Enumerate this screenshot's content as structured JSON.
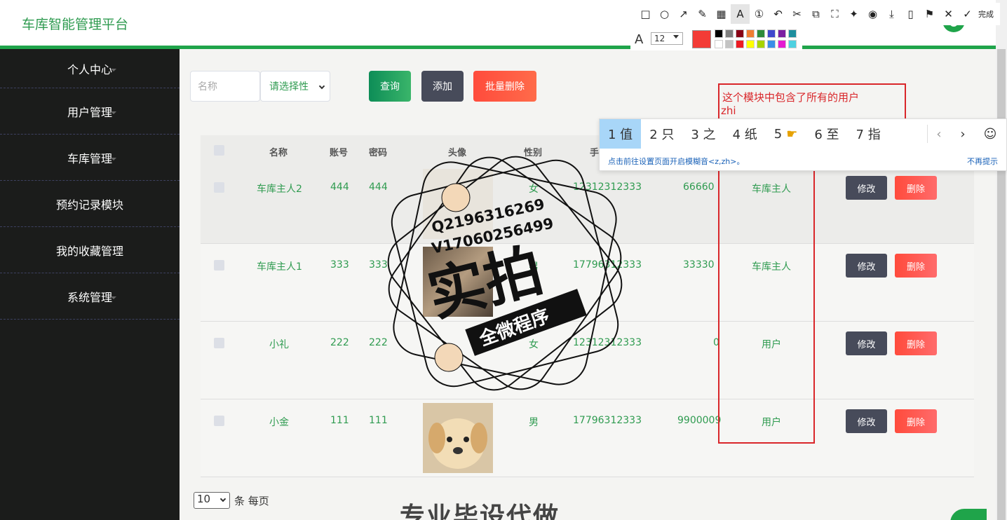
{
  "header": {
    "brand": "车库智能管理平台"
  },
  "sidebar": {
    "items": [
      {
        "label": "个人中心"
      },
      {
        "label": "用户管理"
      },
      {
        "label": "车库管理"
      },
      {
        "label": "预约记录模块"
      },
      {
        "label": "我的收藏管理"
      },
      {
        "label": "系统管理"
      }
    ]
  },
  "search": {
    "name_placeholder": "名称",
    "gender_placeholder": "请选择性",
    "query_label": "查询",
    "add_label": "添加",
    "batch_delete_label": "批量删除"
  },
  "table": {
    "headers": {
      "name": "名称",
      "account": "账号",
      "password": "密码",
      "avatar": "头像",
      "gender": "性别",
      "phone": "手"
    },
    "rows": [
      {
        "name": "车库主人2",
        "account": "444",
        "password": "444",
        "gender": "女",
        "phone": "12312312333",
        "balance": "66660",
        "role": "车库主人",
        "edit": "修改",
        "delete": "删除"
      },
      {
        "name": "车库主人1",
        "account": "333",
        "password": "333",
        "gender": "男",
        "phone": "17796312333",
        "balance": "33330",
        "role": "车库主人",
        "edit": "修改",
        "delete": "删除"
      },
      {
        "name": "小礼",
        "account": "222",
        "password": "222",
        "gender": "女",
        "phone": "12312312333",
        "balance": "0",
        "role": "用户",
        "edit": "修改",
        "delete": "删除"
      },
      {
        "name": "小金",
        "account": "111",
        "password": "111",
        "gender": "男",
        "phone": "17796312333",
        "balance": "9900009",
        "role": "用户",
        "edit": "修改",
        "delete": "删除"
      }
    ]
  },
  "pagination": {
    "page_size": "10",
    "suffix": "条 每页"
  },
  "annotation_toolbar": {
    "done_label": "完成",
    "font_size": "12",
    "current_color": "#f33b36",
    "palette": [
      "#000000",
      "#7f7f7f",
      "#880015",
      "#f07d32",
      "#2d8a3a",
      "#3f48cc",
      "#7b1fa2",
      "#1e8e9e",
      "#ffffff",
      "#c3c3c3",
      "#ed1c24",
      "#ffff00",
      "#a8d400",
      "#3b8ee8",
      "#e51bd1",
      "#4fd1e1"
    ],
    "icons": [
      "rectangle-icon",
      "circle-icon",
      "arrow-icon",
      "pen-icon",
      "mosaic-icon",
      "text-icon",
      "number-icon",
      "undo-icon",
      "crop-icon",
      "ocr-icon",
      "screen-icon",
      "pin-icon",
      "record-icon",
      "download-icon",
      "phone-icon",
      "bookmark-icon",
      "close-icon",
      "check-icon"
    ]
  },
  "annotation": {
    "text": "这个模块中包含了所有的用户",
    "typing": "zhi"
  },
  "ime": {
    "candidates": [
      "1 值",
      "2 只",
      "3 之",
      "4 纸",
      "5",
      "6 至",
      "7 指"
    ],
    "hint": "点击前往设置页面开启模糊音<z,zh>。",
    "no_more": "不再提示"
  },
  "watermark": {
    "qq": "Q2196316269",
    "wechat": "V17060256499",
    "main": "实拍",
    "banner": "全微程序",
    "bottom": "专业毕设代做"
  }
}
